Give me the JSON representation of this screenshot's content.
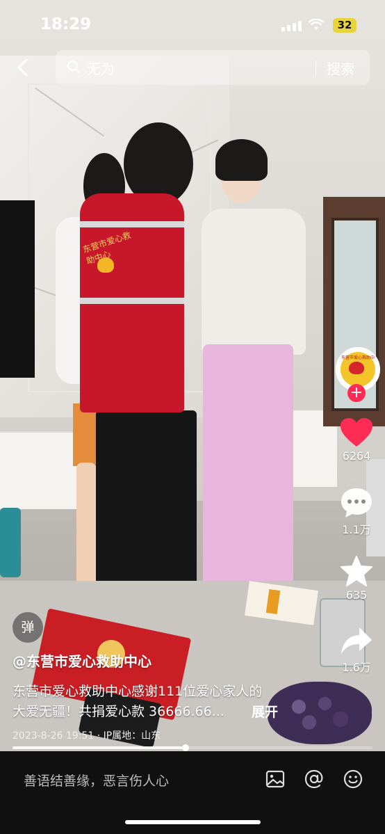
{
  "status_bar": {
    "time": "18:29",
    "battery": "32",
    "battery_color": "#e8d33c"
  },
  "search": {
    "query": "无为",
    "button_label": "搜索"
  },
  "video": {
    "vest_text": "东营市爱心救助中心"
  },
  "creator": {
    "avatar_text": "东营市爱心救助中心"
  },
  "actions": {
    "likes": "6264",
    "comments": "1.1万",
    "favorites": "635",
    "shares": "1.6万"
  },
  "post": {
    "danmu_label": "弹",
    "author": "@东营市爱心救助中心",
    "desc_line1": "东营市爱心救助中心感谢111位爱心家人的",
    "desc_line2": "大爱无疆！共捐爱心款 36666.66...",
    "expand_label": "展开",
    "meta": "2023-8-26 19:51 · IP属地：山东",
    "progress": 0.48
  },
  "comment_bar": {
    "placeholder": "善语结善缘，恶言伤人心"
  },
  "colors": {
    "like_red": "#fe2c55",
    "accent_pink": "#fe2c55"
  }
}
